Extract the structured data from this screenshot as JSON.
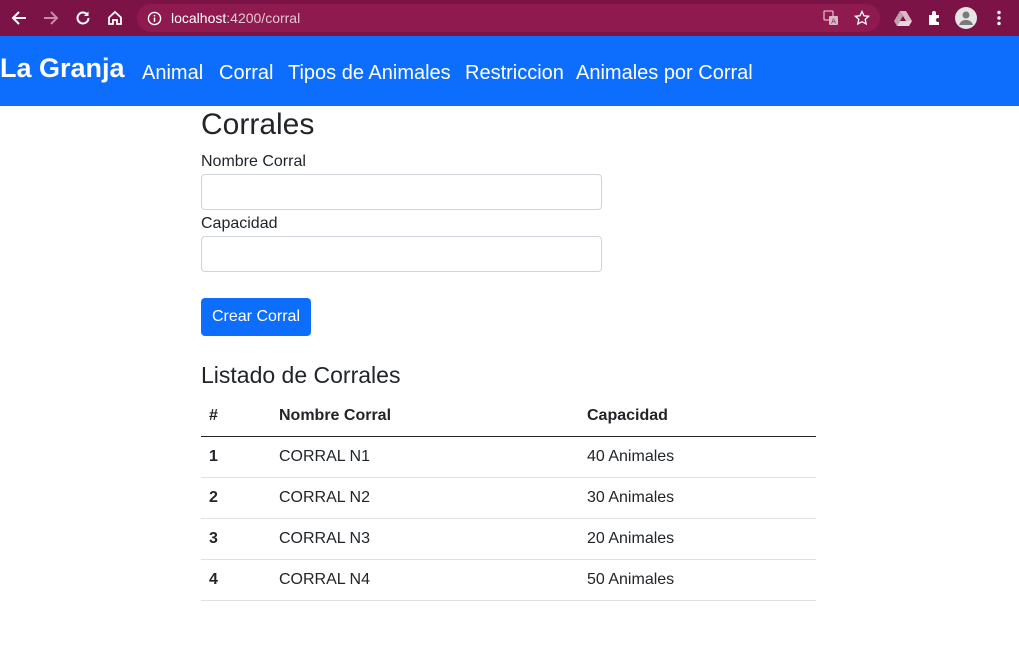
{
  "browser": {
    "url_host": "localhost",
    "url_rest": ":4200/corral",
    "icons": [
      "back-arrow-icon",
      "forward-arrow-icon",
      "reload-icon",
      "home-icon",
      "site-info-icon",
      "translate-icon",
      "bookmark-star-icon",
      "drive-icon",
      "extensions-icon",
      "profile-avatar-icon",
      "menu-icon"
    ],
    "chrome_color": "#7b1346"
  },
  "navbar": {
    "brand": "La Granja",
    "links": [
      "Animal",
      "Corral",
      "Tipos de Animales",
      "Restriccion",
      "Animales por Corral"
    ],
    "bg_color": "#0d6efd"
  },
  "form": {
    "title": "Corrales",
    "name_label": "Nombre Corral",
    "name_value": "",
    "capacity_label": "Capacidad",
    "capacity_value": "",
    "submit_label": "Crear Corral"
  },
  "list": {
    "title": "Listado de Corrales",
    "headers": [
      "#",
      "Nombre Corral",
      "Capacidad"
    ],
    "rows": [
      [
        "1",
        "CORRAL N1",
        "40 Animales"
      ],
      [
        "2",
        "CORRAL N2",
        "30 Animales"
      ],
      [
        "3",
        "CORRAL N3",
        "20 Animales"
      ],
      [
        "4",
        "CORRAL N4",
        "50 Animales"
      ]
    ]
  }
}
